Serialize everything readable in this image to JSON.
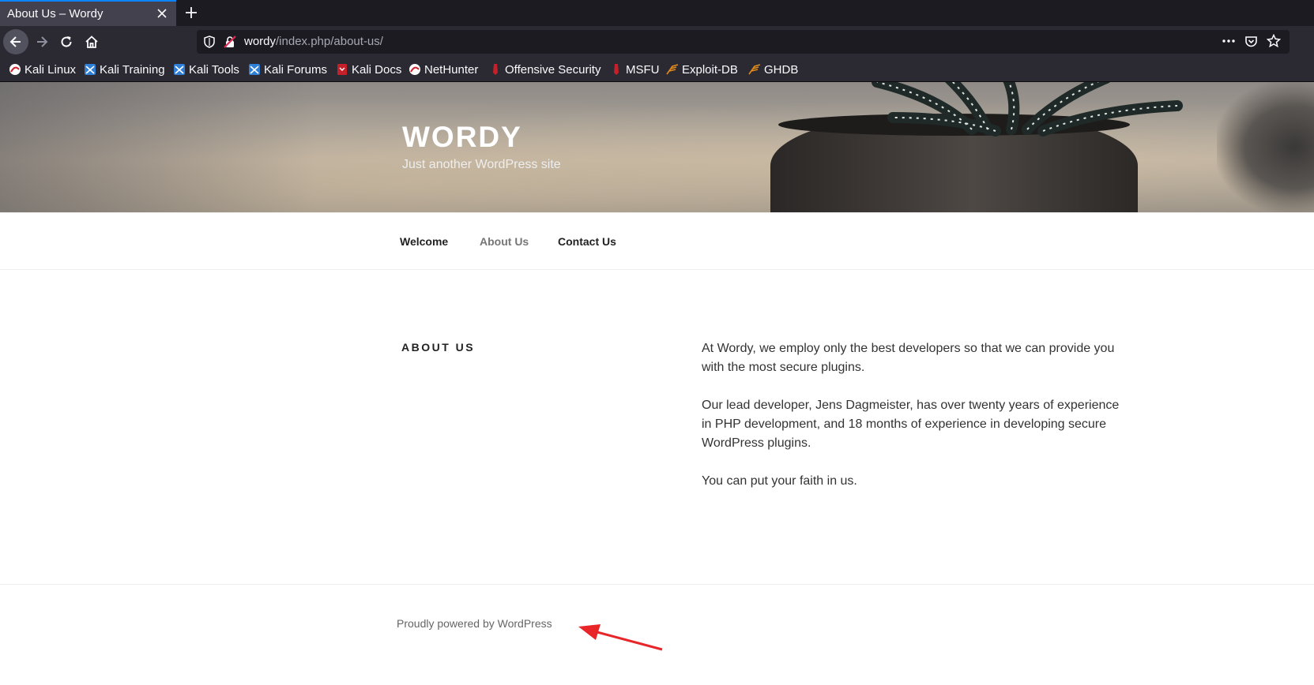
{
  "browser": {
    "tab_title": "About Us – Wordy",
    "url_host": "wordy",
    "url_path": "/index.php/about-us/",
    "bookmarks": [
      {
        "label": "Kali Linux",
        "icon": "kali-icon"
      },
      {
        "label": "Kali Training",
        "icon": "kali-training-icon"
      },
      {
        "label": "Kali Tools",
        "icon": "kali-tools-icon"
      },
      {
        "label": "Kali Forums",
        "icon": "kali-forums-icon"
      },
      {
        "label": "Kali Docs",
        "icon": "kali-docs-icon"
      },
      {
        "label": "NetHunter",
        "icon": "nethunter-icon"
      },
      {
        "label": "Offensive Security",
        "icon": "offsec-icon"
      },
      {
        "label": "MSFU",
        "icon": "msfu-icon"
      },
      {
        "label": "Exploit-DB",
        "icon": "exploitdb-icon"
      },
      {
        "label": "GHDB",
        "icon": "ghdb-icon"
      }
    ]
  },
  "site": {
    "title": "WORDY",
    "description": "Just another WordPress site"
  },
  "menu": {
    "items": [
      "Welcome",
      "About Us",
      "Contact Us"
    ],
    "current": "About Us"
  },
  "page": {
    "title": "ABOUT US",
    "paragraphs": [
      "At Wordy, we employ only the best developers so that we can provide you with the most secure plugins.",
      "Our lead developer, Jens Dagmeister, has over twenty years of experience in PHP development, and 18 months of experience in developing secure WordPress plugins.",
      "You can put your faith in us."
    ]
  },
  "footer": {
    "text": "Proudly powered by WordPress"
  },
  "colors": {
    "accent_tab": "#0a84ff",
    "annotation_arrow": "#e8262a"
  }
}
